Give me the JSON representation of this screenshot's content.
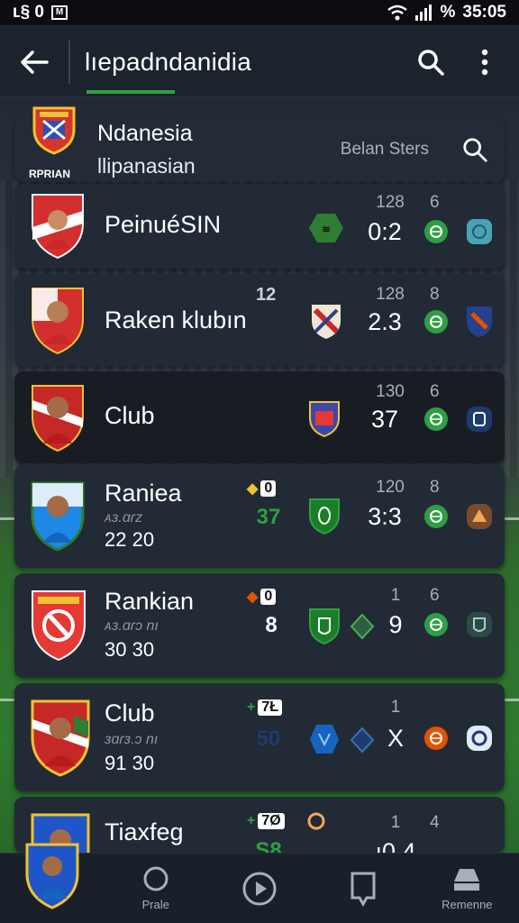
{
  "status_bar": {
    "left_text": "ʟ§ 0",
    "right_text": "35:05",
    "signal_percent": "%"
  },
  "app_bar": {
    "title": "lıepadndanidia"
  },
  "header": {
    "title": "Ndanesia",
    "subtitle": "llipanasian",
    "crest_caption": "RPRIAN",
    "filter_label": "Belan Sters"
  },
  "rows": [
    {
      "name": "PeinuéSIN",
      "stat_top": "128",
      "stat_top_2": "6",
      "score": "0:2",
      "style": "normal"
    },
    {
      "name": "Raken klubın",
      "badge": "12",
      "stat_top": "128",
      "stat_top_2": "8",
      "score": "2.3",
      "style": "normal"
    },
    {
      "name": "Club",
      "stat_top": "130",
      "stat_top_2": "6",
      "score": "37",
      "style": "dark"
    },
    {
      "name": "Raniea",
      "meta": "ᴀɜ.ɑɾz",
      "time": "22 20",
      "badge": "0",
      "mid_value": "37",
      "stat_top": "120",
      "stat_top_2": "8",
      "score": "3:3",
      "style": "normal"
    },
    {
      "name": "Rankian",
      "meta": "ᴀɜ.ɑɾɔ nı",
      "time": "30 30",
      "badge": "0",
      "mid_value": "8",
      "stat_top": "1",
      "stat_top_2": "6",
      "score": "9",
      "style": "normal"
    },
    {
      "name": "Club",
      "meta": "ɜɑɾɜ.ɔ nı",
      "time": "91 30",
      "badge": "7Ł",
      "mid_value": "50",
      "stat_top": "1",
      "stat_top_2": "",
      "score": "X",
      "style": "normal"
    },
    {
      "name": "Tiaxfeg",
      "badge": "7Ø",
      "mid_value": "S8",
      "stat_top": "1",
      "stat_top_2": "4",
      "score": "ı0 4",
      "style": "normal"
    }
  ],
  "bottom_nav": [
    {
      "label": "",
      "icon": "player-avatar-icon"
    },
    {
      "label": "Prale",
      "icon": "search-circle-icon"
    },
    {
      "label": "",
      "icon": "play-icon"
    },
    {
      "label": "",
      "icon": "bookmark-icon"
    },
    {
      "label": "Remenne",
      "icon": "inbox-icon"
    }
  ],
  "colors": {
    "accent_green": "#2ea043",
    "card_bg": "#212a35",
    "card_dark_bg": "#181d24",
    "crest_red": "#d32f2f"
  }
}
